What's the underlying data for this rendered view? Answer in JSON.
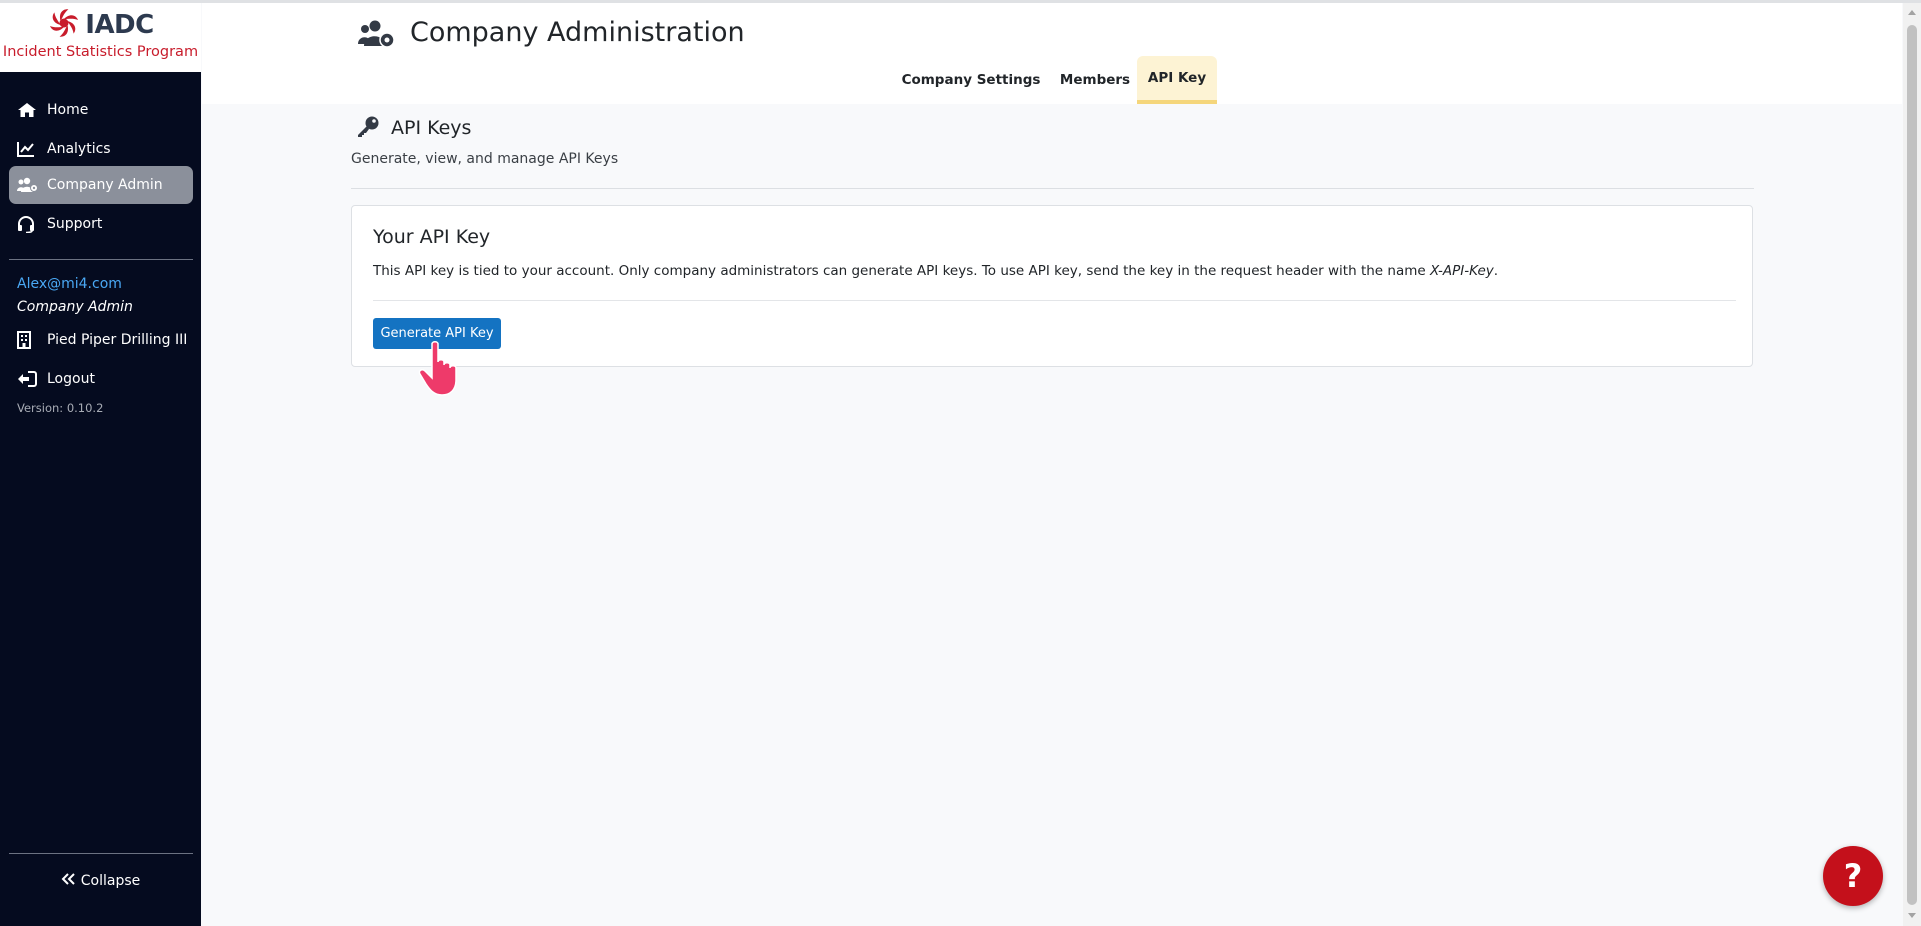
{
  "brand": {
    "logo_text": "IADC",
    "subtitle": "Incident Statistics Program",
    "logo_color": "#c81c2b"
  },
  "sidebar": {
    "items": [
      {
        "label": "Home",
        "icon": "home-icon"
      },
      {
        "label": "Analytics",
        "icon": "chart-line-icon"
      },
      {
        "label": "Company Admin",
        "icon": "users-cog-icon",
        "active": true
      },
      {
        "label": "Support",
        "icon": "headset-icon"
      }
    ],
    "user_email": "Alex@mi4.com",
    "user_role": "Company Admin",
    "company": "Pied Piper Drilling III",
    "logout_label": "Logout",
    "version": "Version: 0.10.2",
    "collapse_label": "Collapse"
  },
  "header": {
    "title": "Company Administration",
    "tabs": [
      {
        "label": "Company Settings"
      },
      {
        "label": "Members"
      },
      {
        "label": "API Key",
        "active": true
      }
    ]
  },
  "section": {
    "title": "API Keys",
    "subtitle": "Generate, view, and manage API Keys"
  },
  "card": {
    "title": "Your API Key",
    "description": "This API key is tied to your account. Only company administrators can generate API keys. To use API key, send the key in the request header with the name ",
    "header_name": "X-API-Key",
    "description_end": ".",
    "button_label": "Generate API Key"
  },
  "help": {
    "label": "?"
  },
  "colors": {
    "sidebar_bg": "#050b1f",
    "primary_button": "#1473c2",
    "active_tab": "#fdf3d4",
    "help_button": "#c4101b"
  }
}
